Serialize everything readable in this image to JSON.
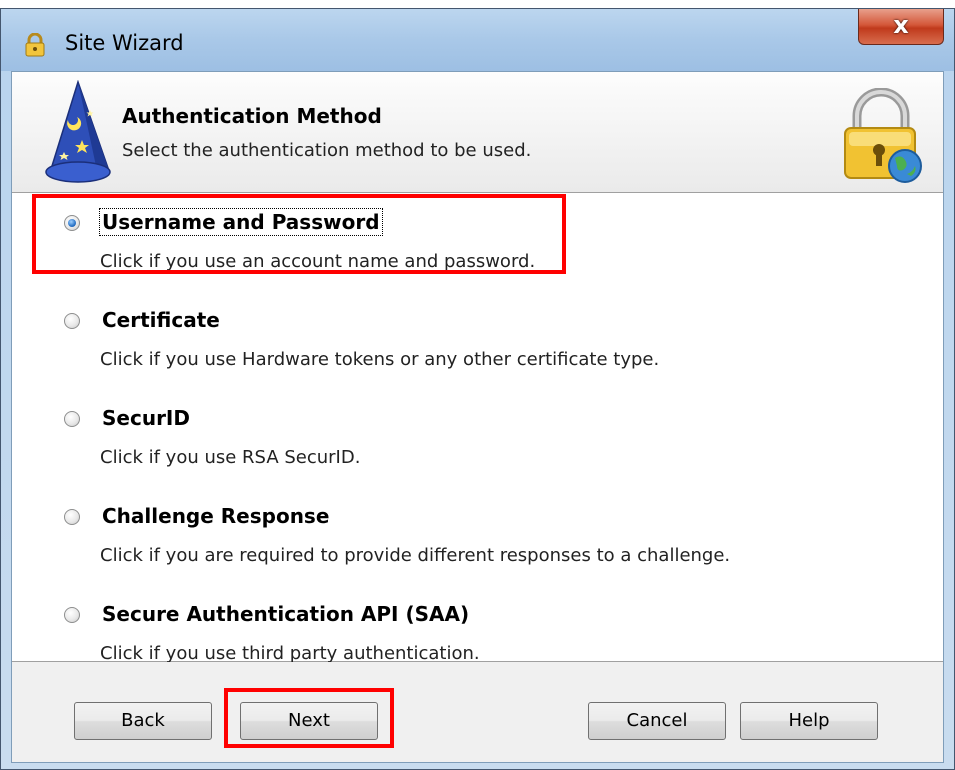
{
  "window": {
    "title": "Site Wizard",
    "close_symbol": "x"
  },
  "header": {
    "title": "Authentication Method",
    "subtitle": "Select the authentication method to be used.",
    "left_icon": "wizard-hat-icon",
    "right_icon": "lock-globe-icon"
  },
  "options": [
    {
      "label": "Username and Password",
      "description": "Click if you use an account name and password.",
      "selected": true
    },
    {
      "label": "Certificate",
      "description": "Click if you use Hardware tokens or any other certificate type.",
      "selected": false
    },
    {
      "label": "SecurID",
      "description": "Click if you use RSA SecurID.",
      "selected": false
    },
    {
      "label": "Challenge Response",
      "description": "Click if you are required to provide different responses to a challenge.",
      "selected": false
    },
    {
      "label": "Secure Authentication API (SAA)",
      "description": "Click if you use third party authentication.",
      "selected": false
    }
  ],
  "buttons": {
    "back": "Back",
    "next": "Next",
    "cancel": "Cancel",
    "help": "Help"
  },
  "colors": {
    "annotation_highlight": "#ff0000"
  }
}
